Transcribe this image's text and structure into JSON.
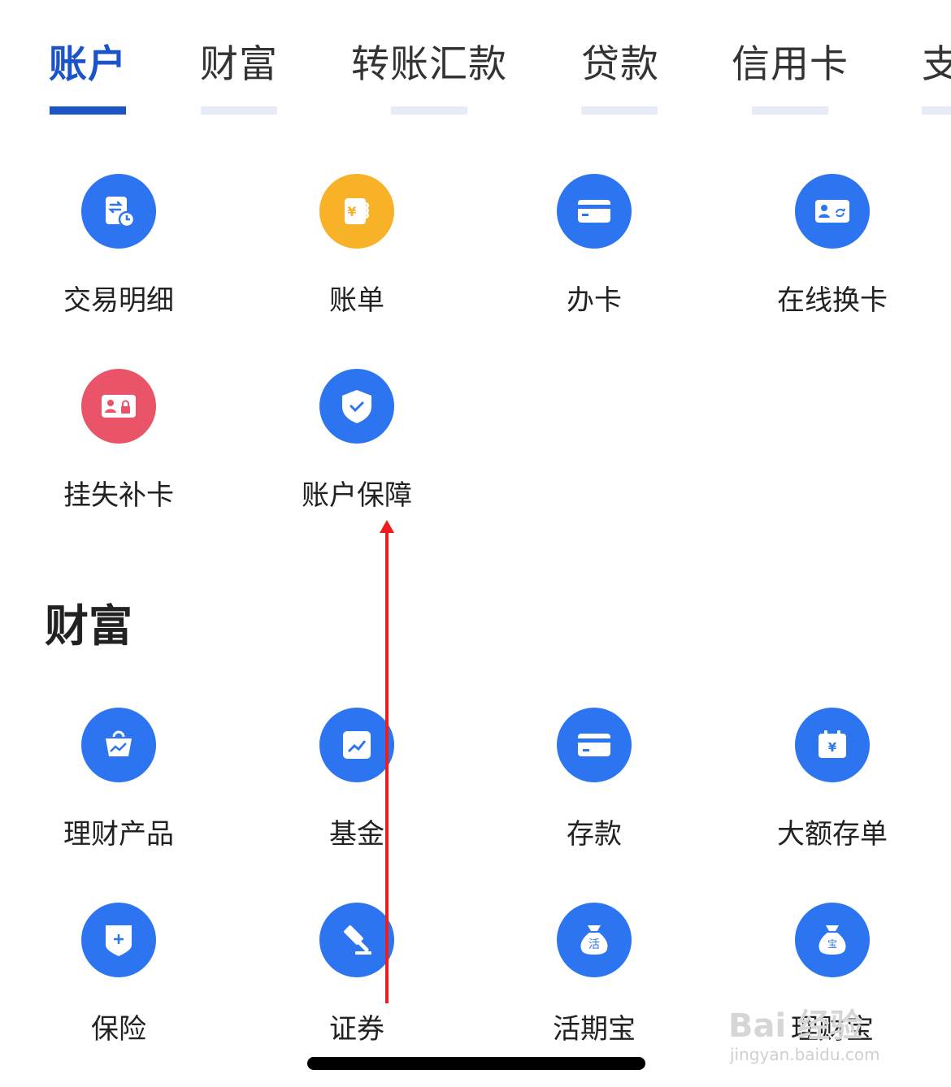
{
  "tabs": [
    {
      "label": "账户",
      "active": true
    },
    {
      "label": "财富",
      "active": false
    },
    {
      "label": "转账汇款",
      "active": false
    },
    {
      "label": "贷款",
      "active": false
    },
    {
      "label": "信用卡",
      "active": false
    },
    {
      "label": "支",
      "active": false
    }
  ],
  "account_section": {
    "items": [
      {
        "label": "交易明细",
        "icon": "transaction-detail-icon",
        "color": "#2d74f0"
      },
      {
        "label": "账单",
        "icon": "bill-icon",
        "color": "#f7b227"
      },
      {
        "label": "办卡",
        "icon": "card-icon",
        "color": "#2d74f0"
      },
      {
        "label": "在线换卡",
        "icon": "card-replace-icon",
        "color": "#2d74f0"
      },
      {
        "label": "挂失补卡",
        "icon": "report-lost-card-icon",
        "color": "#ea5468"
      },
      {
        "label": "账户保障",
        "icon": "shield-check-icon",
        "color": "#2d74f0"
      }
    ]
  },
  "wealth_section": {
    "title": "财富",
    "items": [
      {
        "label": "理财产品",
        "icon": "wealth-bag-icon",
        "color": "#2d74f0"
      },
      {
        "label": "基金",
        "icon": "fund-chart-icon",
        "color": "#2d74f0"
      },
      {
        "label": "存款",
        "icon": "deposit-card-icon",
        "color": "#2d74f0"
      },
      {
        "label": "大额存单",
        "icon": "certificate-deposit-icon",
        "color": "#2d74f0"
      },
      {
        "label": "保险",
        "icon": "insurance-shield-icon",
        "color": "#2d74f0"
      },
      {
        "label": "证券",
        "icon": "gavel-icon",
        "color": "#2d74f0"
      },
      {
        "label": "活期宝",
        "icon": "money-bag-huo-icon",
        "color": "#2d74f0"
      },
      {
        "label": "理财宝",
        "icon": "money-bag-bao-icon",
        "color": "#2d74f0"
      }
    ],
    "bag_labels": {
      "huo": "活",
      "bao": "宝"
    }
  },
  "colors": {
    "accent": "#1b53c9",
    "icon_blue": "#2d74f0",
    "icon_orange": "#f7b227",
    "icon_red": "#ea5468",
    "annotation_red": "#ee1c1c"
  },
  "watermark": {
    "main": "Bai 经验",
    "sub": "jingyan.baidu.com"
  }
}
